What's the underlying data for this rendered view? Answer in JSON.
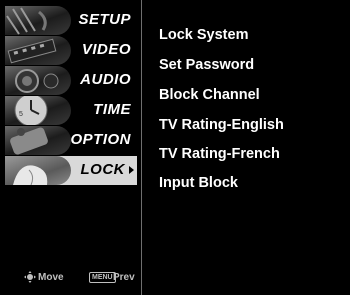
{
  "menu": {
    "items": [
      {
        "label": "SETUP",
        "icon": "setup-image"
      },
      {
        "label": "VIDEO",
        "icon": "video-film-image"
      },
      {
        "label": "AUDIO",
        "icon": "audio-speaker-image"
      },
      {
        "label": "TIME",
        "icon": "clock-image"
      },
      {
        "label": "OPTION",
        "icon": "option-image"
      },
      {
        "label": "LOCK",
        "icon": "lock-image",
        "selected": true
      }
    ],
    "footer": {
      "move_label": "Move",
      "menu_key": "MENU",
      "prev_label": "Prev"
    }
  },
  "submenu": {
    "items": [
      "Lock System",
      "Set Password",
      "Block Channel",
      "TV Rating-English",
      "TV Rating-French",
      "Input Block"
    ]
  },
  "colors": {
    "background": "#000000",
    "text": "#ffffff",
    "selected_background": "#d9d9d9",
    "divider": "#6f6f6f"
  }
}
